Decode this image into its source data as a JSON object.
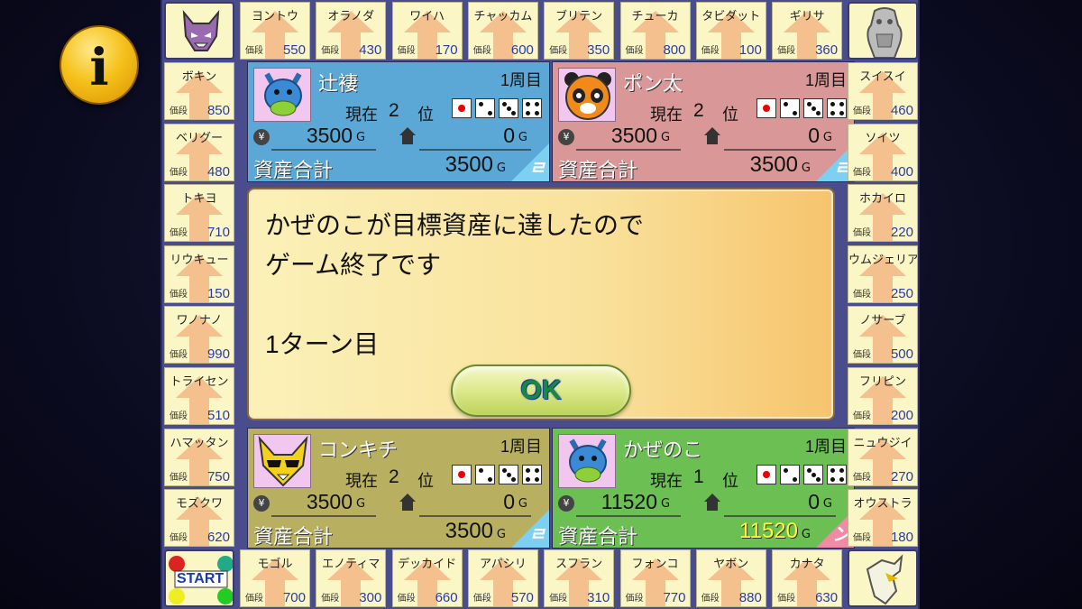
{
  "info_button": {
    "glyph": "i"
  },
  "top_tiles": [
    {
      "name": "ヨントウ",
      "price": "550"
    },
    {
      "name": "オラノダ",
      "price": "430"
    },
    {
      "name": "ワイハ",
      "price": "170"
    },
    {
      "name": "チャッカム",
      "price": "600"
    },
    {
      "name": "ブリテン",
      "price": "350"
    },
    {
      "name": "チューカ",
      "price": "800"
    },
    {
      "name": "タビダット",
      "price": "100"
    },
    {
      "name": "ギリサ",
      "price": "360"
    }
  ],
  "left_tiles": [
    {
      "name": "ボキン",
      "price": "850"
    },
    {
      "name": "ベリグー",
      "price": "480"
    },
    {
      "name": "トキヨ",
      "price": "710"
    },
    {
      "name": "リウキュー",
      "price": "150"
    },
    {
      "name": "ワノナノ",
      "price": "990"
    },
    {
      "name": "トライセン",
      "price": "510"
    },
    {
      "name": "ハマッタン",
      "price": "750"
    },
    {
      "name": "モズクワ",
      "price": "620"
    }
  ],
  "right_tiles": [
    {
      "name": "スイスイ",
      "price": "460"
    },
    {
      "name": "ソイツ",
      "price": "400"
    },
    {
      "name": "ホカイロ",
      "price": "220"
    },
    {
      "name": "ウムジェリア",
      "price": "250"
    },
    {
      "name": "ノサーブ",
      "price": "500"
    },
    {
      "name": "フリピン",
      "price": "200"
    },
    {
      "name": "ニュウジイ",
      "price": "270"
    },
    {
      "name": "オウストラ",
      "price": "180"
    }
  ],
  "bottom_tiles": [
    {
      "name": "モゴル",
      "price": "700"
    },
    {
      "name": "エノティマ",
      "price": "300"
    },
    {
      "name": "デッカイド",
      "price": "660"
    },
    {
      "name": "アパシリ",
      "price": "570"
    },
    {
      "name": "スフラン",
      "price": "310"
    },
    {
      "name": "フォンコ",
      "price": "770"
    },
    {
      "name": "ヤボン",
      "price": "880"
    },
    {
      "name": "カナタ",
      "price": "630"
    }
  ],
  "price_label": "価段",
  "start_label": "START",
  "players": [
    {
      "name": "辻褄",
      "lap": "1周目",
      "rank_label": "現在",
      "rank": "2",
      "rank_suffix": "位",
      "money": "3500",
      "property": "0",
      "currency": "G",
      "asset_label": "資産合計",
      "asset": "3500",
      "color": "#5ba8d6",
      "avatar": "blue-creature",
      "corner_glyph": "ㄹ"
    },
    {
      "name": "ポン太",
      "lap": "1周目",
      "rank_label": "現在",
      "rank": "2",
      "rank_suffix": "位",
      "money": "3500",
      "property": "0",
      "currency": "G",
      "asset_label": "資産合計",
      "asset": "3500",
      "color": "#d99797",
      "avatar": "panda",
      "corner_glyph": "ㄹ"
    },
    {
      "name": "コンキチ",
      "lap": "1周目",
      "rank_label": "現在",
      "rank": "2",
      "rank_suffix": "位",
      "money": "3500",
      "property": "0",
      "currency": "G",
      "asset_label": "資産合計",
      "asset": "3500",
      "color": "#b8b060",
      "avatar": "fox-sunglasses",
      "corner_glyph": "ㄹ"
    },
    {
      "name": "かぜのこ",
      "lap": "1周目",
      "rank_label": "現在",
      "rank": "1",
      "rank_suffix": "位",
      "money": "11520",
      "property": "0",
      "currency": "G",
      "asset_label": "資産合計",
      "asset": "11520",
      "color": "#6cbf52",
      "avatar": "blue-creature",
      "corner_glyph": "ン"
    }
  ],
  "dialog": {
    "line1": "かぜのこが目標資産に達したので",
    "line2": "ゲーム終了です",
    "line3": "1ターン目",
    "ok_label": "OK"
  },
  "colors": {
    "board": "#4a4d8c",
    "tile": "#fbf6c6",
    "price": "#2a3aa8",
    "winner_asset": "#ffff33"
  }
}
